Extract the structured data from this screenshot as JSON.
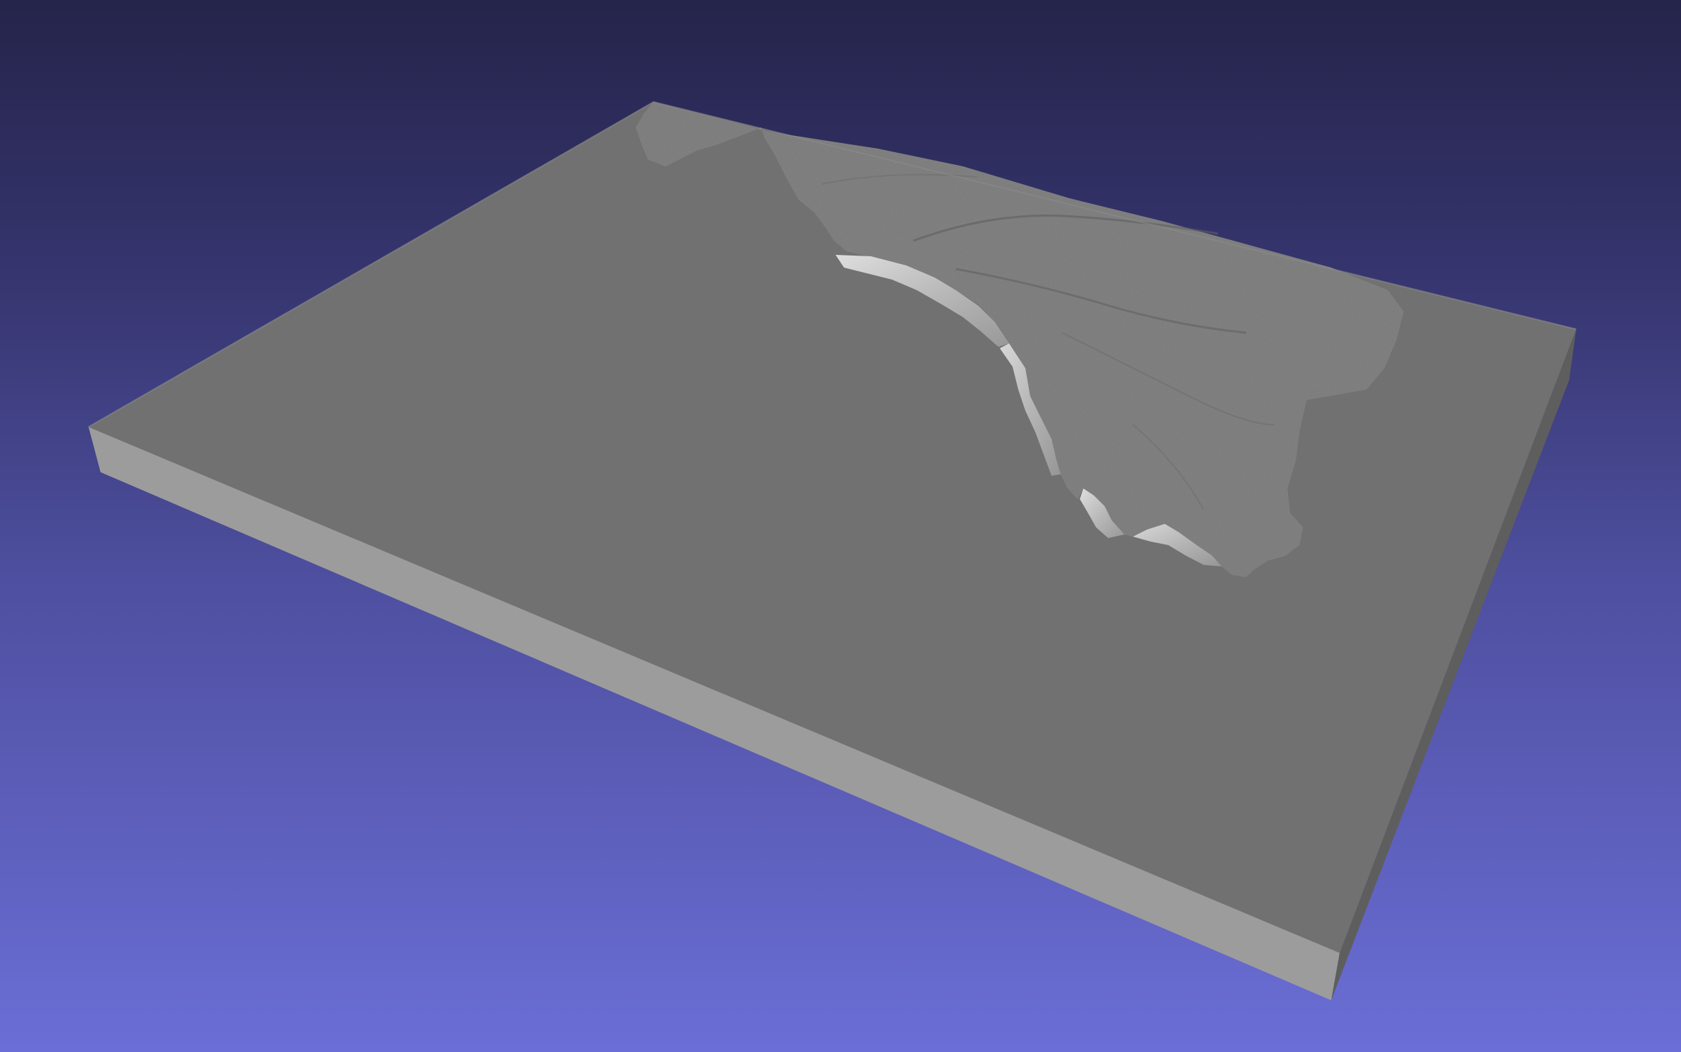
{
  "app": {
    "view": "3d-mesh-viewport"
  },
  "scene": {
    "object": "terrain-relief-model",
    "background_top_color": "#25244a",
    "background_bottom_color": "#6b6ed6",
    "base_top_color": "#717171",
    "base_front_color": "#9c9c9c",
    "base_right_color": "#5e5e5e",
    "terrain_color": "#8a8a8a"
  }
}
